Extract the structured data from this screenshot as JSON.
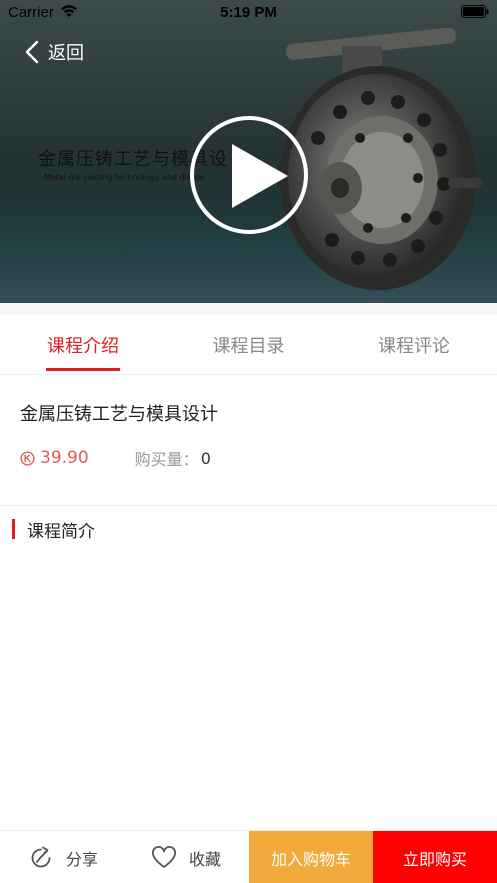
{
  "status_bar": {
    "carrier": "Carrier",
    "time": "5:19 PM"
  },
  "video": {
    "back_label": "返回",
    "thumbnail_title": "金属压铸工艺与模具设",
    "thumbnail_subtitle": "Metal die casting technology and die de"
  },
  "tabs": [
    {
      "label": "课程介绍",
      "active": true
    },
    {
      "label": "课程目录",
      "active": false
    },
    {
      "label": "课程评论",
      "active": false
    }
  ],
  "course": {
    "title": "金属压铸工艺与模具设计",
    "price": "39.90",
    "sales_label": "购买量：",
    "sales_value": "0"
  },
  "section": {
    "title": "课程简介"
  },
  "bottom_bar": {
    "share_label": "分享",
    "favorite_label": "收藏",
    "add_to_cart_label": "加入购物车",
    "buy_now_label": "立即购买"
  },
  "colors": {
    "accent": "#e02020",
    "price": "#e05a5a",
    "cart": "#f0a93a",
    "buy": "#ff0000"
  }
}
